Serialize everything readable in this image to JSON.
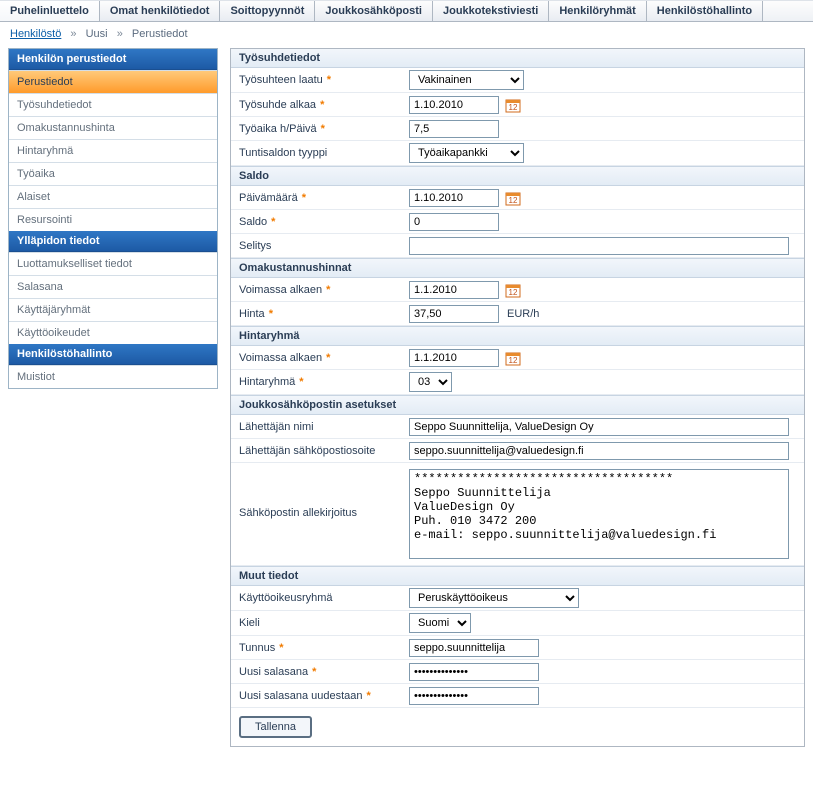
{
  "topnav": {
    "tabs": [
      {
        "label": "Puhelinluettelo"
      },
      {
        "label": "Omat henkilötiedot"
      },
      {
        "label": "Soittopyynnöt"
      },
      {
        "label": "Joukkosähköposti"
      },
      {
        "label": "Joukkotekstiviesti"
      },
      {
        "label": "Henkilöryhmät"
      },
      {
        "label": "Henkilöstöhallinto"
      }
    ],
    "active_index": 0
  },
  "breadcrumb": {
    "parts": [
      {
        "label": "Henkilöstö",
        "link": true
      },
      {
        "label": "Uusi",
        "link": false
      },
      {
        "label": "Perustiedot",
        "link": false
      }
    ],
    "separator": "»"
  },
  "sidebar": {
    "groups": [
      {
        "header": "Henkilön perustiedot",
        "items": [
          {
            "label": "Perustiedot",
            "active": true
          },
          {
            "label": "Työsuhdetiedot"
          },
          {
            "label": "Omakustannushinta"
          },
          {
            "label": "Hintaryhmä"
          },
          {
            "label": "Työaika"
          },
          {
            "label": "Alaiset"
          },
          {
            "label": "Resursointi"
          }
        ]
      },
      {
        "header": "Ylläpidon tiedot",
        "items": [
          {
            "label": "Luottamukselliset tiedot"
          },
          {
            "label": "Salasana"
          },
          {
            "label": "Käyttäjäryhmät"
          },
          {
            "label": "Käyttöoikeudet"
          }
        ]
      },
      {
        "header": "Henkilöstöhallinto",
        "items": [
          {
            "label": "Muistiot"
          }
        ]
      }
    ]
  },
  "sections": {
    "tyosuhdetiedot": {
      "title": "Työsuhdetiedot",
      "laatu_label": "Työsuhteen laatu",
      "laatu_value": "Vakinainen",
      "alkaa_label": "Työsuhde alkaa",
      "alkaa_value": "1.10.2010",
      "tyoaika_label": "Työaika h/Päivä",
      "tyoaika_value": "7,5",
      "tuntisaldo_label": "Tuntisaldon tyyppi",
      "tuntisaldo_value": "Työaikapankki"
    },
    "saldo": {
      "title": "Saldo",
      "pvm_label": "Päivämäärä",
      "pvm_value": "1.10.2010",
      "saldo_label": "Saldo",
      "saldo_value": "0",
      "selitys_label": "Selitys",
      "selitys_value": ""
    },
    "omakustannus": {
      "title": "Omakustannushinnat",
      "voimassa_label": "Voimassa alkaen",
      "voimassa_value": "1.1.2010",
      "hinta_label": "Hinta",
      "hinta_value": "37,50",
      "hinta_unit": "EUR/h"
    },
    "hintaryhma": {
      "title": "Hintaryhmä",
      "voimassa_label": "Voimassa alkaen",
      "voimassa_value": "1.1.2010",
      "ryhma_label": "Hintaryhmä",
      "ryhma_value": "03"
    },
    "joukkosahkoposti": {
      "title": "Joukkosähköpostin asetukset",
      "lahettaja_label": "Lähettäjän nimi",
      "lahettaja_value": "Seppo Suunnittelija, ValueDesign Oy",
      "osoite_label": "Lähettäjän sähköpostiosoite",
      "osoite_value": "seppo.suunnittelija@valuedesign.fi",
      "allekirjoitus_label": "Sähköpostin allekirjoitus",
      "allekirjoitus_value": "************************************\nSeppo Suunnittelija\nValueDesign Oy\nPuh. 010 3472 200\ne-mail: seppo.suunnittelija@valuedesign.fi"
    },
    "muut": {
      "title": "Muut tiedot",
      "ryhma_label": "Käyttöoikeusryhmä",
      "ryhma_value": "Peruskäyttöoikeus",
      "kieli_label": "Kieli",
      "kieli_value": "Suomi",
      "tunnus_label": "Tunnus",
      "tunnus_value": "seppo.suunnittelija",
      "uusi_salasana_label": "Uusi salasana",
      "uusi_salasana_value": "●●●●●●●●●●●●●●",
      "uusi_salasana2_label": "Uusi salasana uudestaan",
      "uusi_salasana2_value": "●●●●●●●●●●●●●●"
    }
  },
  "buttons": {
    "save": "Tallenna"
  },
  "icons": {
    "calendar": "calendar-icon"
  }
}
